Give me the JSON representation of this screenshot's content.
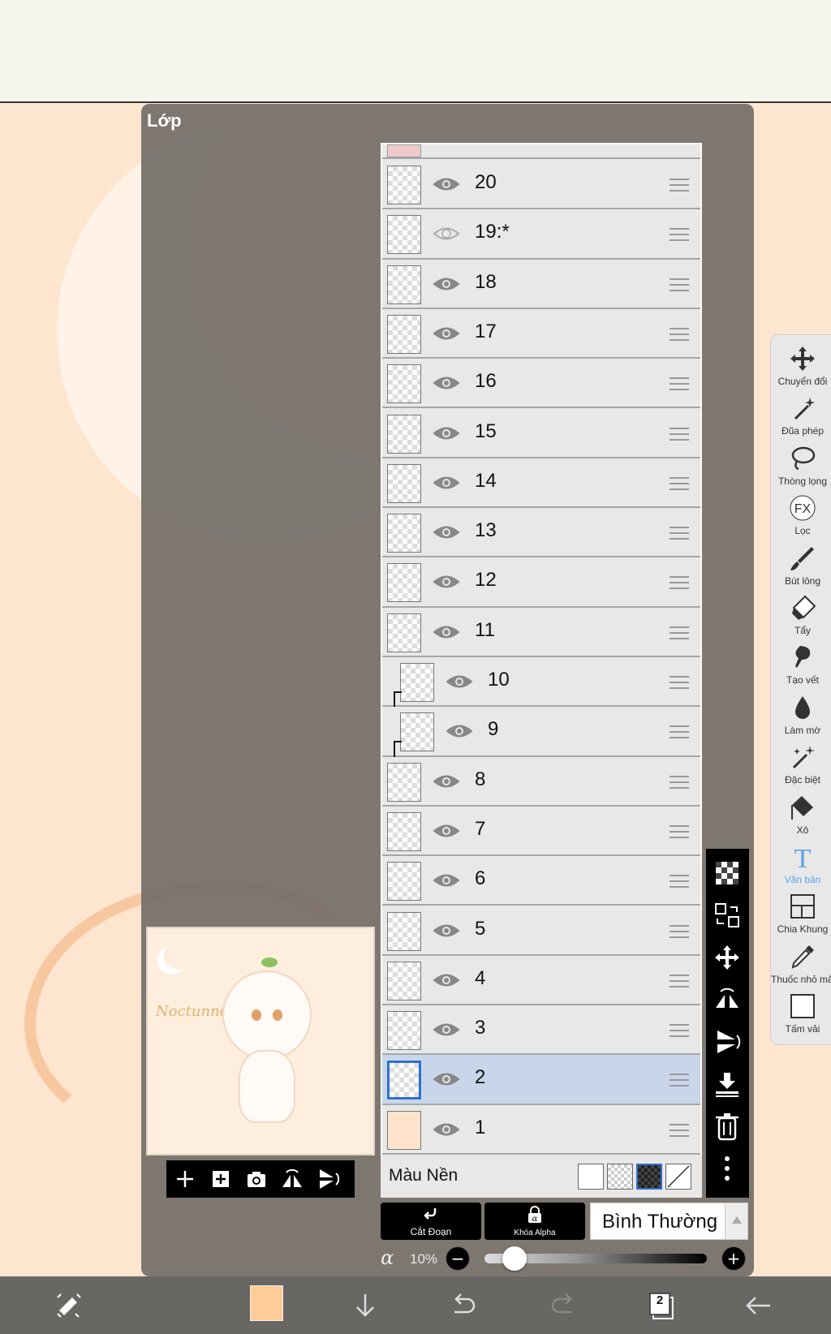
{
  "panel": {
    "title": "Lớp"
  },
  "layers": [
    {
      "name": "20",
      "visible": true,
      "clipped": false,
      "thumb": "checker"
    },
    {
      "name": "19:*",
      "visible": false,
      "clipped": false,
      "thumb": "checker"
    },
    {
      "name": "18",
      "visible": true,
      "clipped": false,
      "thumb": "checker"
    },
    {
      "name": "17",
      "visible": true,
      "clipped": false,
      "thumb": "checker"
    },
    {
      "name": "16",
      "visible": true,
      "clipped": false,
      "thumb": "checker"
    },
    {
      "name": "15",
      "visible": true,
      "clipped": false,
      "thumb": "checker"
    },
    {
      "name": "14",
      "visible": true,
      "clipped": false,
      "thumb": "checker"
    },
    {
      "name": "13",
      "visible": true,
      "clipped": false,
      "thumb": "checker"
    },
    {
      "name": "12",
      "visible": true,
      "clipped": false,
      "thumb": "checker"
    },
    {
      "name": "11",
      "visible": true,
      "clipped": false,
      "thumb": "checker"
    },
    {
      "name": "10",
      "visible": true,
      "clipped": true,
      "thumb": "checker"
    },
    {
      "name": "9",
      "visible": true,
      "clipped": true,
      "thumb": "checker"
    },
    {
      "name": "8",
      "visible": true,
      "clipped": false,
      "thumb": "checker"
    },
    {
      "name": "7",
      "visible": true,
      "clipped": false,
      "thumb": "checker"
    },
    {
      "name": "6",
      "visible": true,
      "clipped": false,
      "thumb": "checker"
    },
    {
      "name": "5",
      "visible": true,
      "clipped": false,
      "thumb": "checker"
    },
    {
      "name": "4",
      "visible": true,
      "clipped": false,
      "thumb": "checker"
    },
    {
      "name": "3",
      "visible": true,
      "clipped": false,
      "thumb": "checker"
    },
    {
      "name": "2",
      "visible": true,
      "clipped": false,
      "thumb": "checker",
      "selected": true
    },
    {
      "name": "1",
      "visible": true,
      "clipped": false,
      "thumb": "solid"
    }
  ],
  "background_row": {
    "label": "Màu Nền"
  },
  "buttons": {
    "clipping": "Cắt Đoạn",
    "alpha_lock": "Khóa Alpha"
  },
  "blend_mode": {
    "value": "Bình Thường"
  },
  "opacity": {
    "symbol": "α",
    "value": "10%",
    "fraction": 0.1,
    "minus": "−",
    "plus": "+"
  },
  "tools": [
    {
      "label": "Chuyển đổi",
      "icon": "move-icon"
    },
    {
      "label": "Đũa phép",
      "icon": "magic-wand-icon"
    },
    {
      "label": "Thòng lọng",
      "icon": "lasso-icon"
    },
    {
      "label": "Lọc",
      "icon": "fx-filter-icon",
      "fx": "FX"
    },
    {
      "label": "Bút lông",
      "icon": "brush-icon"
    },
    {
      "label": "Tẩy",
      "icon": "eraser-icon"
    },
    {
      "label": "Tạo vết",
      "icon": "smudge-icon"
    },
    {
      "label": "Làm mờ",
      "icon": "blur-icon"
    },
    {
      "label": "Đặc biệt",
      "icon": "special-pen-icon"
    },
    {
      "label": "Xô",
      "icon": "bucket-icon"
    },
    {
      "label": "Văn bản",
      "icon": "text-icon",
      "active": true,
      "glyph": "T"
    },
    {
      "label": "Chia Khung",
      "icon": "frame-divider-icon"
    },
    {
      "label": "Thuốc nhỏ mắt",
      "icon": "eyedropper-icon"
    },
    {
      "label": "Tấm vải",
      "icon": "canvas-icon"
    }
  ],
  "bottom_bar": {
    "layer_count": "2",
    "current_color": "#ffcc99"
  },
  "colors": {
    "selected_row": "#c9d6ea",
    "accent": "#2f6fce",
    "text_tool": "#5aa2e6"
  }
}
